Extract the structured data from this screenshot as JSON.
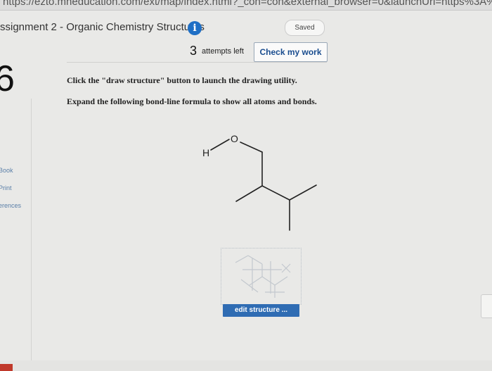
{
  "browser": {
    "url": "https://ezto.mheducation.com/ext/map/index.html?_con=con&external_browser=0&launchUrl=https%3A%2F%2Flms"
  },
  "header": {
    "title": "ssignment 2 - Organic Chemistry Structures",
    "info_glyph": "i",
    "saved_label": "Saved"
  },
  "question": {
    "number": "6",
    "attempts_count": "3",
    "attempts_label": "attempts left",
    "check_label": "Check my work",
    "instruction_1": "Click the \"draw structure\" button to launch the drawing utility.",
    "instruction_2": "Expand the following bond-line formula to show all atoms and bonds.",
    "atom_h": "H",
    "atom_o": "O",
    "edit_label": "edit structure ..."
  },
  "left_links": [
    "Book",
    "Print",
    "erences"
  ]
}
